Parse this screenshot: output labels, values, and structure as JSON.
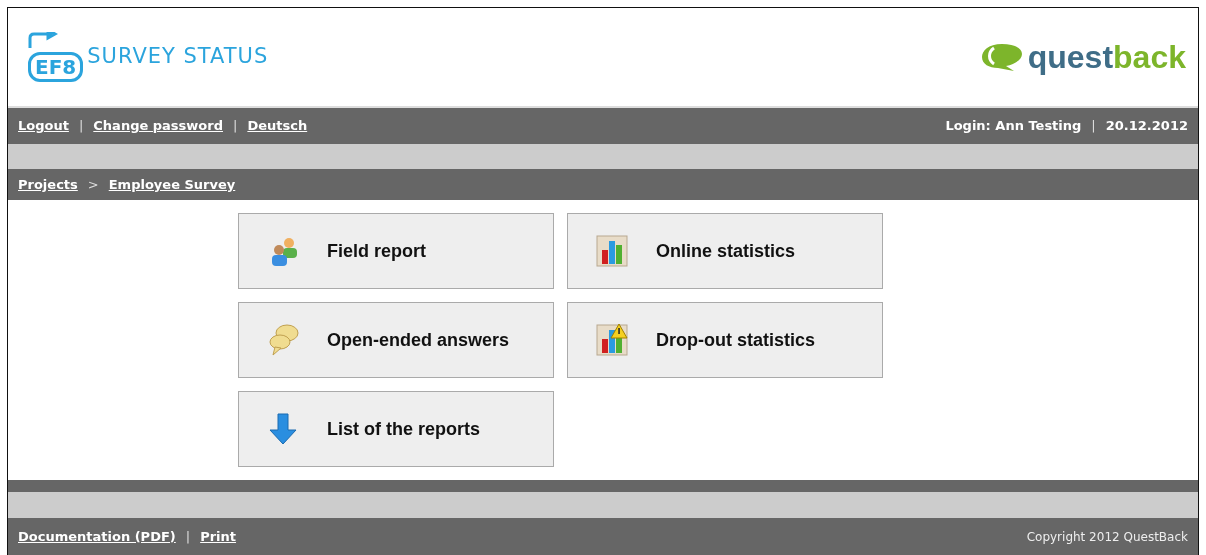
{
  "header": {
    "logo_badge": "EF8",
    "logo_title": "SURVEY STATUS",
    "brand": [
      "quest",
      "back"
    ]
  },
  "top_bar": {
    "links": [
      "Logout",
      "Change password",
      "Deutsch"
    ],
    "separator": "|",
    "login": "Login: Ann Testing",
    "date": "20.12.2012"
  },
  "breadcrumb": {
    "items": [
      "Projects",
      "Employee Survey"
    ],
    "separator": ">"
  },
  "tiles": [
    {
      "label": "Field report",
      "kind": "people"
    },
    {
      "label": "Online statistics",
      "kind": "chart"
    },
    {
      "label": "Open-ended answers",
      "kind": "speech"
    },
    {
      "label": "Drop-out statistics",
      "kind": "chart-warning"
    },
    {
      "label": "List of the reports",
      "kind": "arrow-down"
    }
  ],
  "footer": {
    "links": [
      "Documentation (PDF)",
      "Print"
    ],
    "separator": "|",
    "copyright": "Copyright 2012 QuestBack"
  }
}
